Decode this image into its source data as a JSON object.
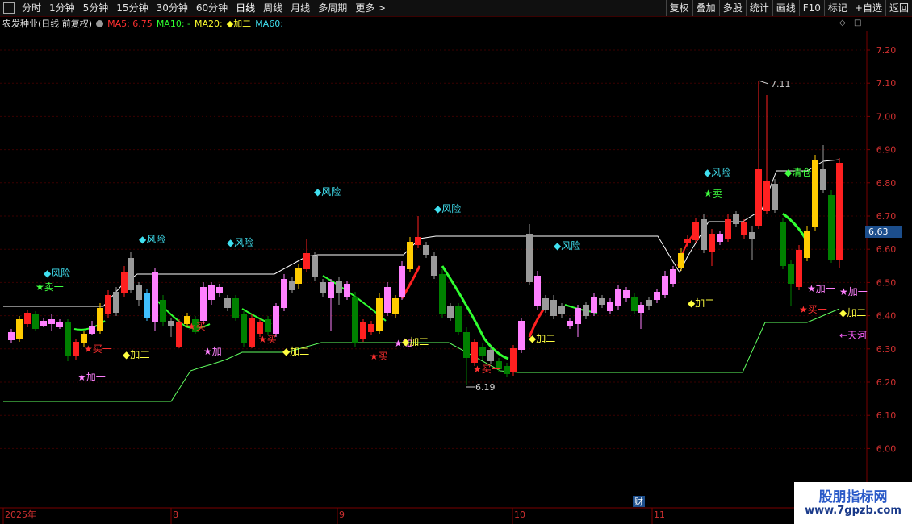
{
  "toolbar": {
    "left_items": [
      "分时",
      "1分钟",
      "5分钟",
      "15分钟",
      "30分钟",
      "60分钟",
      "日线",
      "周线",
      "月线",
      "多周期",
      "更多 >"
    ],
    "right_items": [
      "复权",
      "叠加",
      "多股",
      "统计",
      "画线",
      "F10",
      "标记",
      "+自选",
      "返回"
    ]
  },
  "info": {
    "stock": "农发种业(日线 前复权)",
    "ma5": "MA5: 6.75",
    "ma10": "MA10: -",
    "ma20": "MA20: ",
    "jia_er": "◆加二",
    "ma60": "MA60:"
  },
  "price_axis": [
    "7.20",
    "7.10",
    "7.00",
    "6.90",
    "6.80",
    "6.70",
    "6.60",
    "6.50",
    "6.40",
    "6.30",
    "6.20",
    "6.10",
    "6.00"
  ],
  "current_price": "6.63",
  "date_axis": [
    "2025年",
    "8",
    "9",
    "10",
    "11"
  ],
  "annotations": {
    "high": "7.11",
    "low": "6.19",
    "fin_badge": "财"
  },
  "signals": [
    {
      "text": "◆风险",
      "color": "#40e0f0"
    },
    {
      "text": "★卖一",
      "color": "#40ff40"
    },
    {
      "text": "★买一",
      "color": "#ff3030"
    },
    {
      "text": "★加一",
      "color": "#ff80ff"
    },
    {
      "text": "◆加二",
      "color": "#ffff40"
    },
    {
      "text": "◆清仓",
      "color": "#40ff40"
    },
    {
      "text": "←天河",
      "color": "#ff60ff"
    }
  ],
  "watermark": {
    "title": "股朋指标网",
    "url": "www.7gpzb.com"
  },
  "colors": {
    "up": "#ff2020",
    "down": "#008000",
    "grid": "#3a0000",
    "accent": "#1c4e8c"
  }
}
